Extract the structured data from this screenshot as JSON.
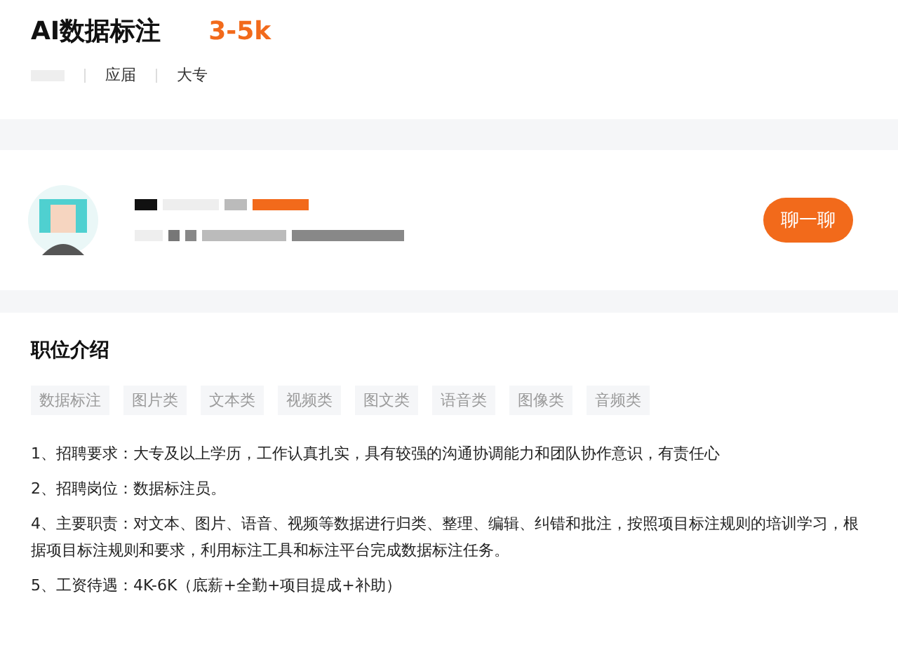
{
  "job": {
    "title": "AI数据标注",
    "salary": "3-5k",
    "tags": [
      "应届",
      "大专"
    ]
  },
  "recruiter": {
    "button": "聊一聊"
  },
  "description": {
    "heading": "职位介绍",
    "keywords": [
      "数据标注",
      "图片类",
      "文本类",
      "视频类",
      "图文类",
      "语音类",
      "图像类",
      "音频类"
    ],
    "lines": [
      "1、招聘要求：大专及以上学历，工作认真扎实，具有较强的沟通协调能力和团队协作意识，有责任心",
      "2、招聘岗位：数据标注员。",
      "4、主要职责：对文本、图片、语音、视频等数据进行归类、整理、编辑、纠错和批注，按照项目标注规则的培训学习，根据项目标注规则和要求，利用标注工具和标注平台完成数据标注任务。",
      "5、工资待遇：4K-6K（底薪+全勤+项目提成+补助）"
    ]
  }
}
